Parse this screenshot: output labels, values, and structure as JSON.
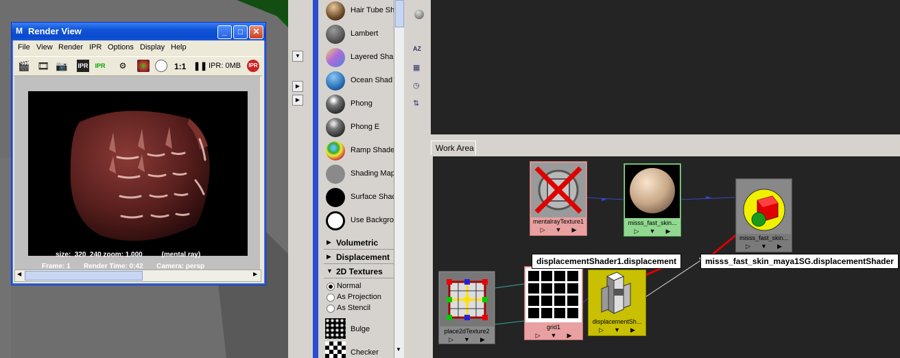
{
  "render_view": {
    "title": "Render View",
    "menu": [
      "File",
      "View",
      "Render",
      "IPR",
      "Options",
      "Display",
      "Help"
    ],
    "toolbar": {
      "ratio": "1:1",
      "ipr_memory": "IPR: 0MB"
    },
    "info_line1": "size:  320  240 zoom: 1.000          (mental ray)",
    "info_line2": "Frame: 1       Render Time: 0:42       Camera: persp"
  },
  "materials": [
    {
      "label": "Hair Tube Sh",
      "color": "#6b4a2a"
    },
    {
      "label": "Lambert",
      "color": "#555555"
    },
    {
      "label": "Layered Sha",
      "color": "#b06cd8"
    },
    {
      "label": "Ocean Shad",
      "color": "#2a6fb8"
    },
    {
      "label": "Phong",
      "color": "#555555"
    },
    {
      "label": "Phong E",
      "color": "#555555"
    },
    {
      "label": "Ramp Shade",
      "color": "#d64a3a"
    },
    {
      "label": "Shading Map",
      "color": "#888888"
    },
    {
      "label": "Surface Shac",
      "color": "#000000"
    },
    {
      "label": "Use Backgro",
      "color": "#ffffff"
    }
  ],
  "categories": [
    {
      "label": "Volumetric"
    },
    {
      "label": "Displacement"
    },
    {
      "label": "2D Textures"
    }
  ],
  "texture_options": [
    "Normal",
    "As Projection",
    "As Stencil"
  ],
  "textures": [
    {
      "label": "Bulge"
    },
    {
      "label": "Checker"
    }
  ],
  "work_area": {
    "tab_label": "Work Area",
    "nodes": {
      "mentalray": "mentalrayTexture1",
      "skin": "misss_fast_skin...",
      "sg": "misss_fast_skin...",
      "place2d": "place2dTexture2",
      "grid": "grid1",
      "disp": "displacementSh..."
    },
    "callouts": {
      "left": "displacementShader1.displacement",
      "right": "misss_fast_skin_maya1SG.displacementShader"
    }
  }
}
